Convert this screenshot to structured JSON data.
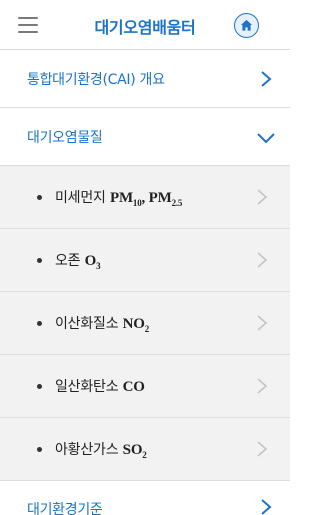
{
  "header": {
    "title": "대기오염배움터",
    "menu_icon": "hamburger-menu-icon",
    "home_icon": "home-icon"
  },
  "menu": {
    "overview_label": "통합대기환경(CAI) 개요",
    "pollutants_label": "대기오염물질",
    "standards_label": "대기환경기준",
    "pollutants_expanded": true
  },
  "submenu": {
    "items": [
      {
        "name": "미세먼지",
        "formula_parts": [
          "PM",
          "10",
          ", PM",
          "2.5"
        ]
      },
      {
        "name": "오존",
        "formula_parts": [
          "O",
          "3"
        ]
      },
      {
        "name": "이산화질소",
        "formula_parts": [
          "NO",
          "2"
        ]
      },
      {
        "name": "일산화탄소",
        "formula_parts": [
          "CO"
        ]
      },
      {
        "name": "아황산가스",
        "formula_parts": [
          "SO",
          "2"
        ]
      }
    ]
  },
  "colors": {
    "accent": "#1c73c9",
    "submenu_bg": "#f2f2f2",
    "divider": "#dcdcdc"
  }
}
